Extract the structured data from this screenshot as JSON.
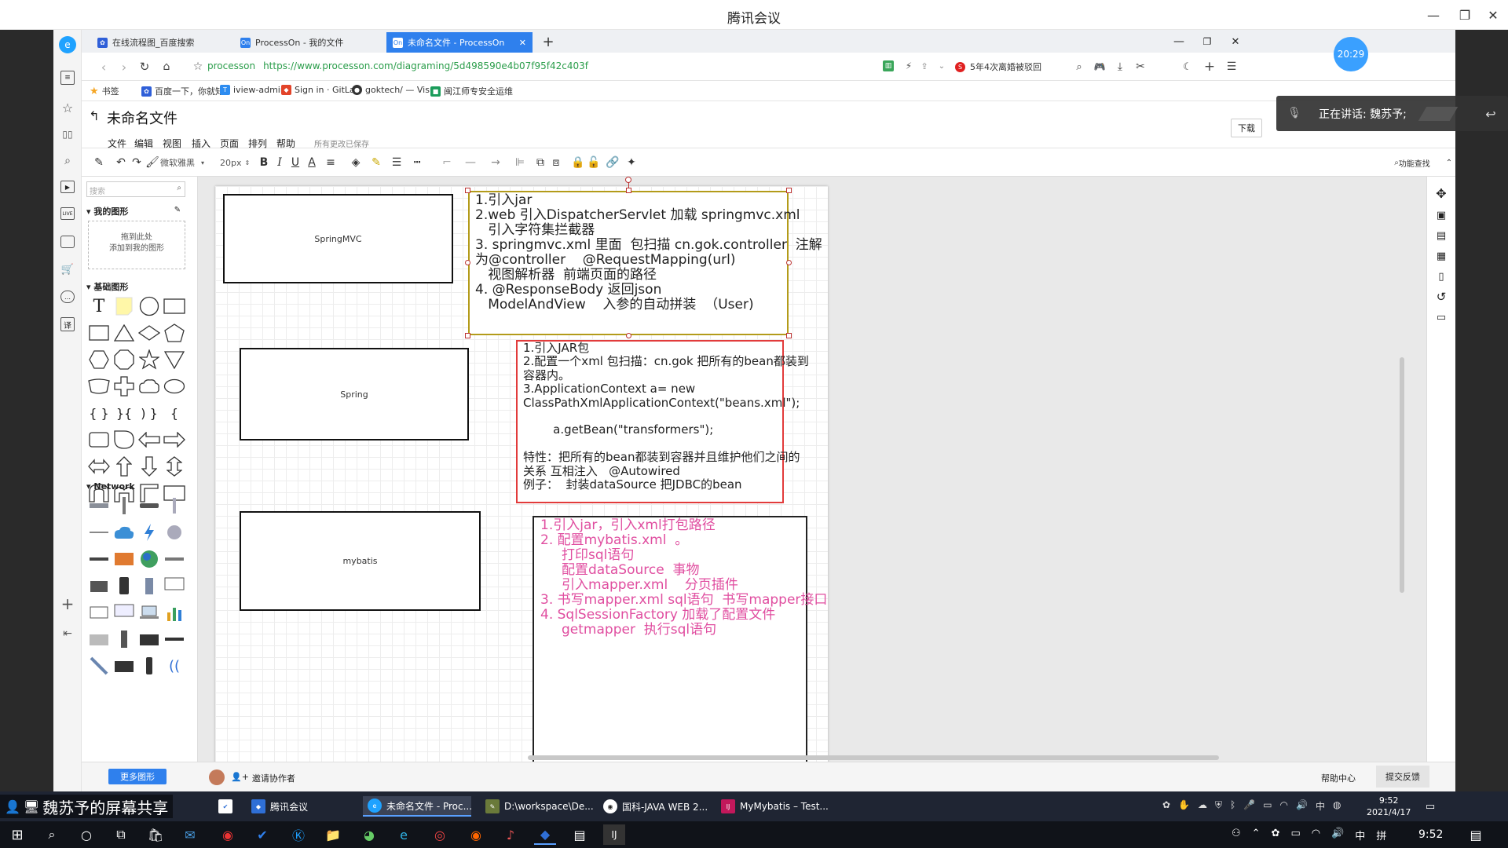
{
  "meeting": {
    "title": "腾讯会议",
    "timer": "20:29",
    "speaking": "正在讲话: 魏苏予;",
    "screen_share": "魏苏予的屏幕共享"
  },
  "tabs": [
    {
      "label": "在线流程图_百度搜索"
    },
    {
      "label": "ProcessOn - 我的文件"
    },
    {
      "label": "未命名文件 - ProcessOn"
    }
  ],
  "address": {
    "site": "processon",
    "url": "https://www.processon.com/diagraming/5d498590e4b07f95f42c403f",
    "news": "5年4次离婚被驳回"
  },
  "bookmarks": [
    "书签",
    "百度一下，你就知",
    "iview-admin",
    "Sign in · GitLab",
    "goktech/ — Visu",
    "闽江师专安全运维"
  ],
  "doc": {
    "title": "未命名文件",
    "menus": [
      "文件",
      "编辑",
      "视图",
      "插入",
      "页面",
      "排列",
      "帮助"
    ],
    "saved": "所有更改已保存",
    "download": "下载"
  },
  "toolbar": {
    "font": "微软雅黑",
    "size": "20px",
    "find": "功能查找"
  },
  "shapes": {
    "search_placeholder": "搜索",
    "my_shapes": "我的图形",
    "drop_hint_1": "拖到此处",
    "drop_hint_2": "添加到我的图形",
    "basic": "基础图形",
    "network": "Network",
    "more": "更多图形"
  },
  "diagram": {
    "springmvc_label": "SpringMVC",
    "spring_label": "Spring",
    "mybatis_label": "mybatis",
    "note1": [
      "1.引入jar",
      "2.web 引入DispatcherServlet 加载 springmvc.xml",
      "   引入字符集拦截器",
      "3. springmvc.xml 里面  包扫描 cn.gok.controller  注解",
      "为@controller    @RequestMapping(url)",
      "   视图解析器  前端页面的路径",
      "4. @ResponseBody 返回json",
      "   ModelAndView    入参的自动拼装  （User)"
    ],
    "note2": [
      "1.引入JAR包",
      "2.配置一个xml 包扫描：cn.gok 把所有的bean都装到",
      "容器内。",
      "3.ApplicationContext a= new",
      "ClassPathXmlApplicationContext(\"beans.xml\");",
      "",
      "        a.getBean(\"transformers\");",
      "",
      "特性：把所有的bean都装到容器并且维护他们之间的",
      "关系 互相注入   @Autowired",
      "例子：  封装dataSource 把JDBC的bean"
    ],
    "note3": [
      "1.引入jar，引入xml打包路径",
      "2. 配置mybatis.xml  。",
      "     打印sql语句",
      "     配置dataSource  事物",
      "     引入mapper.xml    分页插件",
      "3. 书写mapper.xml sql语句  书写mapper接口",
      "4. SqlSessionFactory 加载了配置文件",
      "     getmapper  执行sql语句"
    ]
  },
  "footer": {
    "invite": "邀请协作者",
    "help": "帮助中心",
    "feedback": "提交反馈"
  },
  "taskbar_apps": [
    "腾讯会议",
    "未命名文件 - Proc...",
    "D:\\workspace\\De...",
    "国科-JAVA WEB 2...",
    "MyMybatis – Test..."
  ],
  "tray": {
    "time": "9:52",
    "date": "2021/4/17",
    "ime": "中",
    "ime2": "拼"
  },
  "wintask_time": "9:52",
  "colors": {
    "accent": "#2f80ed",
    "note1_border": "#b39b1a",
    "note2_border": "#e23b3b",
    "note3_text": "#e04ea0"
  }
}
